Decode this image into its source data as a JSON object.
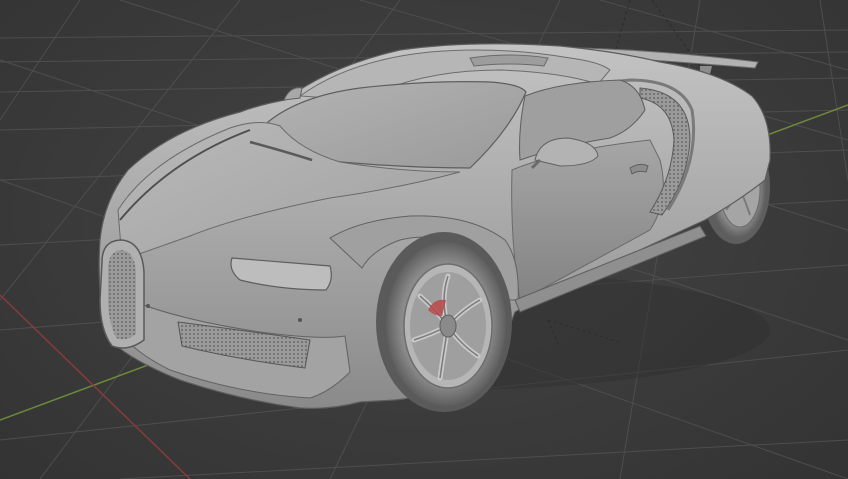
{
  "viewport": {
    "object": "car",
    "shading": "solid",
    "colors": {
      "background": "#3d3d3d",
      "grid_line": "#4c4c4c",
      "axis_x": "#8a3a3a",
      "axis_y": "#6b8a3a",
      "body": "#a7a7a7",
      "body_highlight": "#c6c6c6",
      "body_shadow": "#6f6f6f",
      "glass": "#9e9e9e",
      "tire": "#6e6e6e",
      "rim": "#b5b5b5",
      "grille_mesh": "#8a8a8a",
      "brake_caliper": "#b84848"
    }
  }
}
